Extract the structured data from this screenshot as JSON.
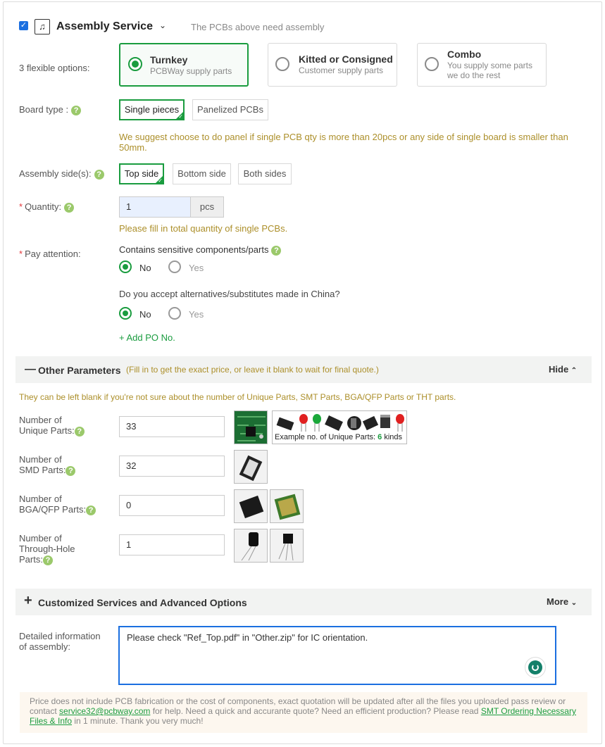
{
  "header": {
    "title": "Assembly Service",
    "subtitle": "The PCBs above need assembly",
    "checked": true
  },
  "options": {
    "label": "3 flexible options:",
    "items": [
      {
        "title": "Turnkey",
        "sub": "PCBWay supply parts",
        "selected": true
      },
      {
        "title": "Kitted or Consigned",
        "sub": "Customer supply parts",
        "selected": false
      },
      {
        "title": "Combo",
        "sub": "You supply some parts",
        "sub2": "we do the rest",
        "selected": false
      }
    ]
  },
  "board_type": {
    "label": "Board type :",
    "choices": [
      "Single pieces",
      "Panelized PCBs"
    ],
    "selected": "Single pieces",
    "hint": "We suggest choose to do panel if single PCB qty is more than 20pcs or any side of single board is smaller than",
    "hint2": "50mm."
  },
  "assembly_side": {
    "label": "Assembly side(s):",
    "choices": [
      "Top side",
      "Bottom side",
      "Both sides"
    ],
    "selected": "Top side"
  },
  "quantity": {
    "label": "Quantity:",
    "value": "1",
    "unit": "pcs",
    "hint": "Please fill in total quantity of single PCBs."
  },
  "attention": {
    "label": "Pay attention:",
    "q1": "Contains sensitive components/parts",
    "q2": "Do you accept alternatives/substitutes made in China?",
    "no": "No",
    "yes": "Yes",
    "add_po": "+ Add PO No."
  },
  "other_params": {
    "title": "Other Parameters",
    "note": "(Fill in to get the exact price, or leave it blank to wait for final quote.)",
    "toggle": "Hide",
    "blank_hint": "They can be left blank if you're not sure about the number of Unique Parts, SMT Parts, BGA/QFP Parts or THT parts.",
    "unique": {
      "label1": "Number of",
      "label2": "Unique Parts:",
      "value": "33"
    },
    "smd": {
      "label1": "Number of",
      "label2": "SMD Parts:",
      "value": "32"
    },
    "bga": {
      "label1": "Number of",
      "label2": "BGA/QFP Parts:",
      "value": "0"
    },
    "tht": {
      "label1": "Number of",
      "label2": "Through-Hole",
      "label3": "Parts:",
      "value": "1"
    },
    "example_text": "Example no. of Unique Parts:",
    "example_count": "6",
    "example_unit": "kinds"
  },
  "custom": {
    "title": "Customized Services and Advanced Options",
    "toggle": "More"
  },
  "detail": {
    "label1": "Detailed information",
    "label2": "of assembly:",
    "value": "Please check \"Ref_Top.pdf\" in \"Other.zip\" for IC orientation."
  },
  "footer": {
    "text1": "Price does not include PCB fabrication or the cost of components, exact quotation will be updated after all the files you uploaded pass review or",
    "text2a": "contact ",
    "email": "service32@pcbway.com",
    "text2b": " for help. Need a quick and accurante quote? Need an efficient production? Please read ",
    "link1": "SMT Ordering Necessary",
    "link2": "Files & Info",
    "text3": " in 1 minute. Thank you very much!"
  },
  "colors": {
    "accent": "#1a9c3f",
    "hint": "#ac8f2a",
    "checkbox": "#1b6fe0"
  }
}
